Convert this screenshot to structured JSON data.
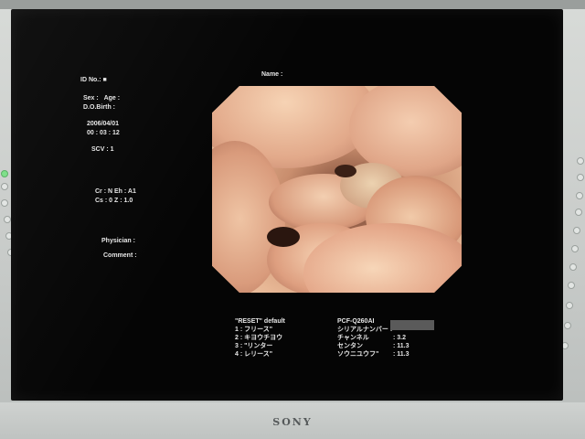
{
  "patient": {
    "id_label": "ID No.:",
    "id_value": "■",
    "name_label": "Name :",
    "sex_label": "Sex :",
    "age_label": "Age :",
    "dob_label": "D.O.Birth :",
    "date": "2006/04/01",
    "time": "00 : 03 : 12",
    "scv": "SCV : 1"
  },
  "enhance": {
    "line1": "Cr : N Eh : A1",
    "line2": "Cs : 0 Z : 1.0"
  },
  "staff": {
    "physician_label": "Physician :",
    "comment_label": "Comment :"
  },
  "reset": {
    "title": "\"RESET\" default",
    "items": [
      "1 : フリース\"",
      "2 : キヨウチヨウ",
      "3 : \"リンター",
      "4 : レリース\""
    ]
  },
  "scope": {
    "model": "PCF-Q260AI",
    "rows": [
      {
        "label": "シリアルナンバー :",
        "value": ""
      },
      {
        "label": "チャンネル",
        "value": ": 3.2"
      },
      {
        "label": "センタン",
        "value": ": 11.3"
      },
      {
        "label": "ソウニユウフ\"",
        "value": ": 11.3"
      }
    ]
  },
  "monitor": {
    "brand": "SONY"
  },
  "colors": {
    "screen": "#050505",
    "osd_text": "#e6e6e6",
    "led": "#7fe08a"
  }
}
